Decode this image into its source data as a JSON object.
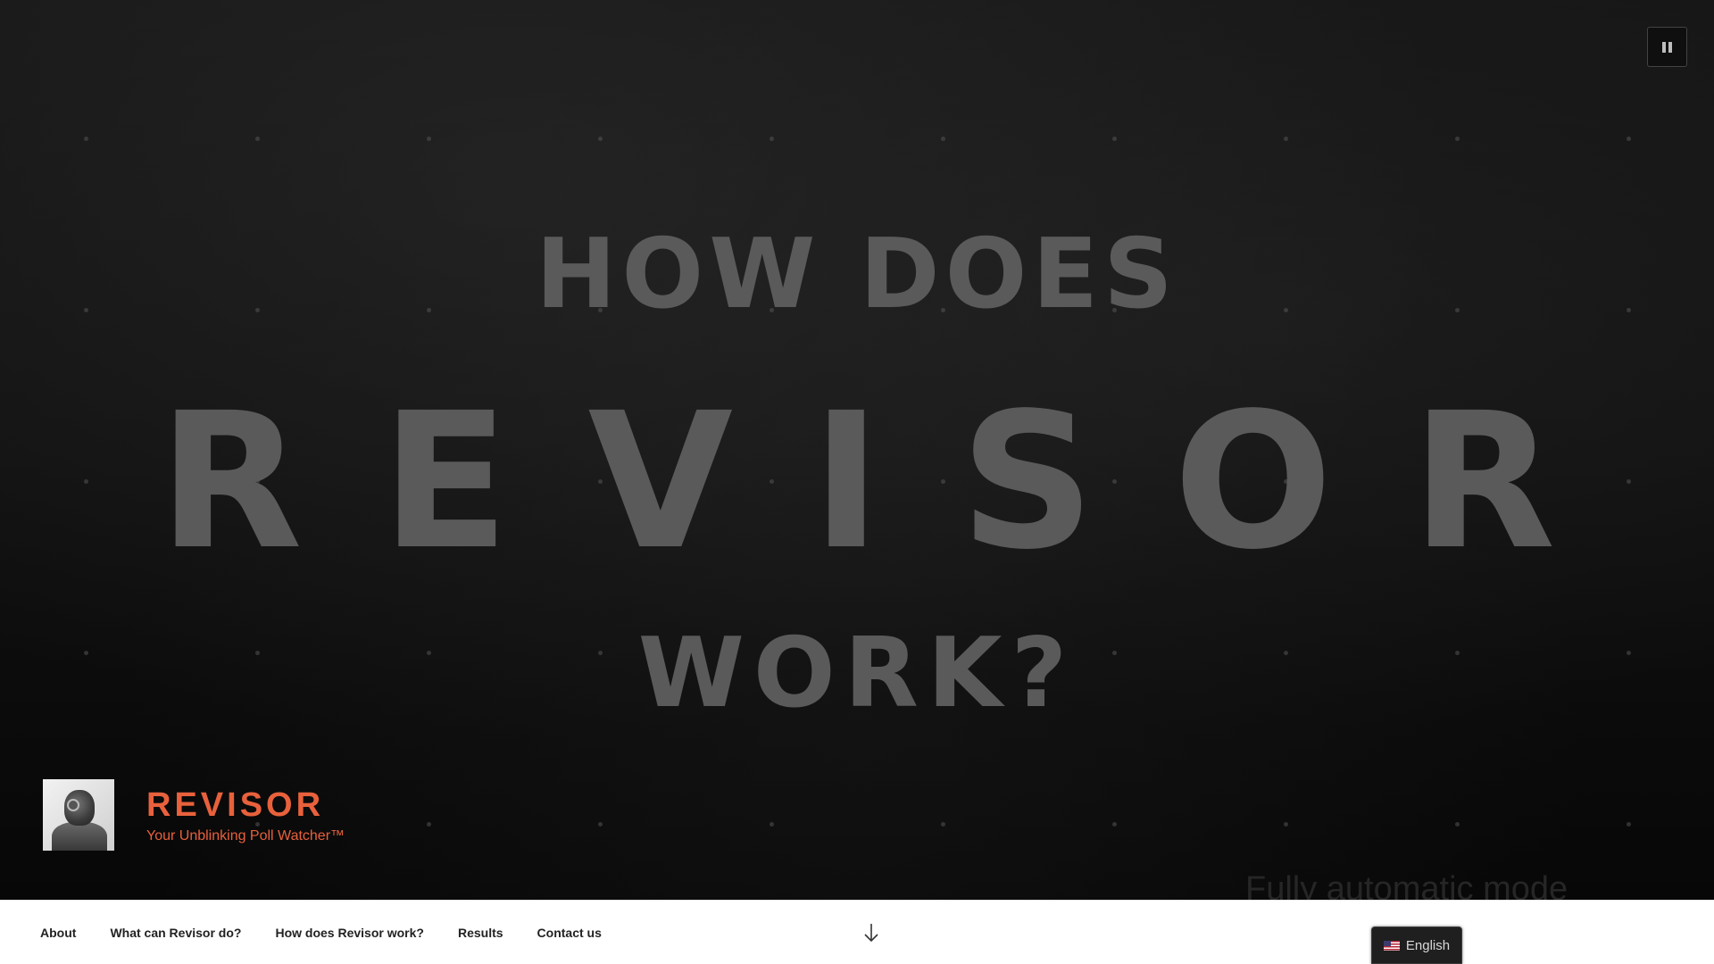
{
  "video": {
    "line1": "HOW DOES",
    "line2": "REVISOR",
    "line3": "WORK?",
    "subtitle": "Fully automatic mode"
  },
  "controls": {
    "pause_icon": "pause-icon"
  },
  "branding": {
    "title": "REVISOR",
    "tagline": "Your Unblinking Poll Watcher™",
    "accent_color": "#e8613c"
  },
  "nav": {
    "items": [
      {
        "label": "About"
      },
      {
        "label": "What can Revisor do?"
      },
      {
        "label": "How does Revisor work?"
      },
      {
        "label": "Results"
      },
      {
        "label": "Contact us"
      }
    ],
    "scroll_icon": "arrow-down-icon"
  },
  "language": {
    "label": "English",
    "flag_icon": "us-flag-icon"
  }
}
